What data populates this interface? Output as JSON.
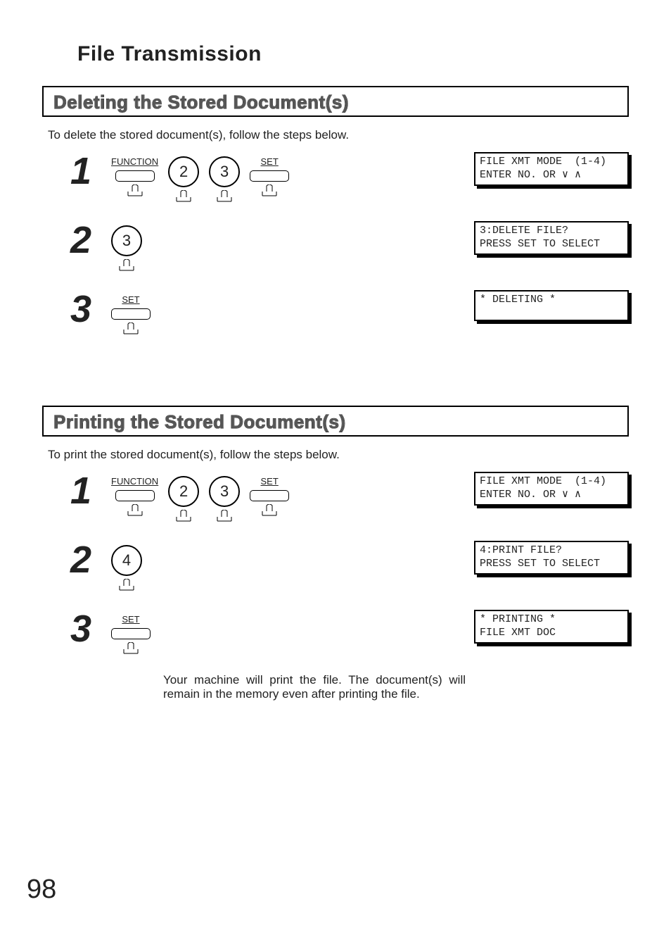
{
  "page": {
    "title": "File Transmission",
    "number": "98"
  },
  "sections": [
    {
      "heading": "Deleting the Stored Document(s)",
      "intro": "To delete the stored document(s), follow the steps below.",
      "steps": [
        {
          "num": "1",
          "keys": [
            {
              "type": "rect",
              "toplabel": "FUNCTION"
            },
            {
              "type": "round",
              "label": "2"
            },
            {
              "type": "round",
              "label": "3"
            },
            {
              "type": "rect",
              "toplabel": "SET"
            }
          ],
          "lcd": "FILE XMT MODE  (1-4)\nENTER NO. OR ∨ ∧"
        },
        {
          "num": "2",
          "keys": [
            {
              "type": "round",
              "label": "3"
            }
          ],
          "lcd": "3:DELETE FILE?\nPRESS SET TO SELECT"
        },
        {
          "num": "3",
          "keys": [
            {
              "type": "rect",
              "toplabel": "SET"
            }
          ],
          "lcd": "* DELETING *"
        }
      ],
      "note": null
    },
    {
      "heading": "Printing the Stored Document(s)",
      "intro": "To print the stored document(s), follow the steps below.",
      "steps": [
        {
          "num": "1",
          "keys": [
            {
              "type": "rect",
              "toplabel": "FUNCTION"
            },
            {
              "type": "round",
              "label": "2"
            },
            {
              "type": "round",
              "label": "3"
            },
            {
              "type": "rect",
              "toplabel": "SET"
            }
          ],
          "lcd": "FILE XMT MODE  (1-4)\nENTER NO. OR ∨ ∧"
        },
        {
          "num": "2",
          "keys": [
            {
              "type": "round",
              "label": "4"
            }
          ],
          "lcd": "4:PRINT FILE?\nPRESS SET TO SELECT"
        },
        {
          "num": "3",
          "keys": [
            {
              "type": "rect",
              "toplabel": "SET"
            }
          ],
          "lcd": "* PRINTING *\nFILE XMT DOC"
        }
      ],
      "note": "Your machine will print the file.  The document(s) will remain in the memory even after printing the file."
    }
  ]
}
